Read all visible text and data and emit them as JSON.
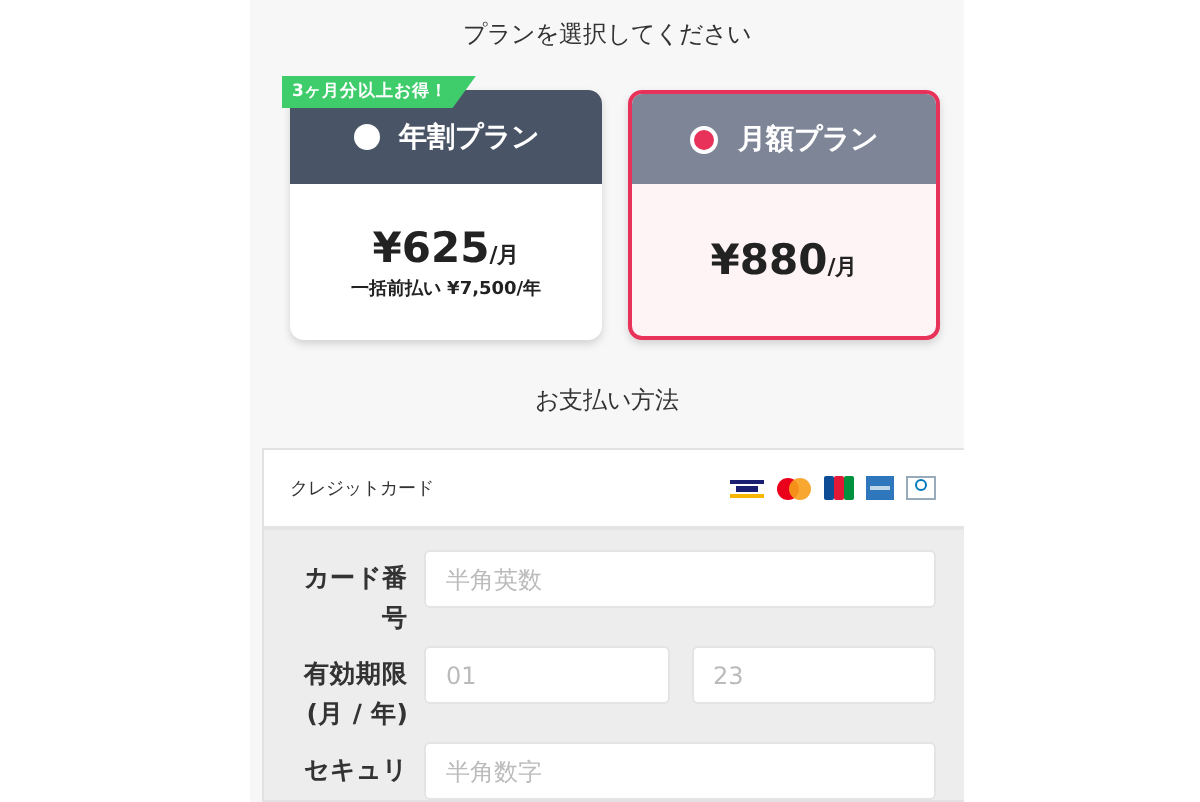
{
  "plan_section": {
    "heading": "プランを選択してください",
    "plans": [
      {
        "name": "年割プラン",
        "selected": false,
        "badge": "3ヶ月分以上お得！",
        "price": "¥625",
        "unit": "/月",
        "note": "一括前払い ¥7,500/年"
      },
      {
        "name": "月額プラン",
        "selected": true,
        "price": "¥880",
        "unit": "/月"
      }
    ]
  },
  "payment_section": {
    "heading": "お支払い方法",
    "method": "クレジットカード",
    "fields": [
      {
        "label": "カード番号",
        "inputs": [
          {
            "placeholder": "半角英数"
          }
        ]
      },
      {
        "label": "有効期限\n(月 / 年)",
        "inputs": [
          {
            "placeholder": "01"
          },
          {
            "placeholder": "23"
          }
        ]
      },
      {
        "label": "セキュリ",
        "inputs": [
          {
            "placeholder": "半角数字"
          }
        ]
      }
    ]
  }
}
